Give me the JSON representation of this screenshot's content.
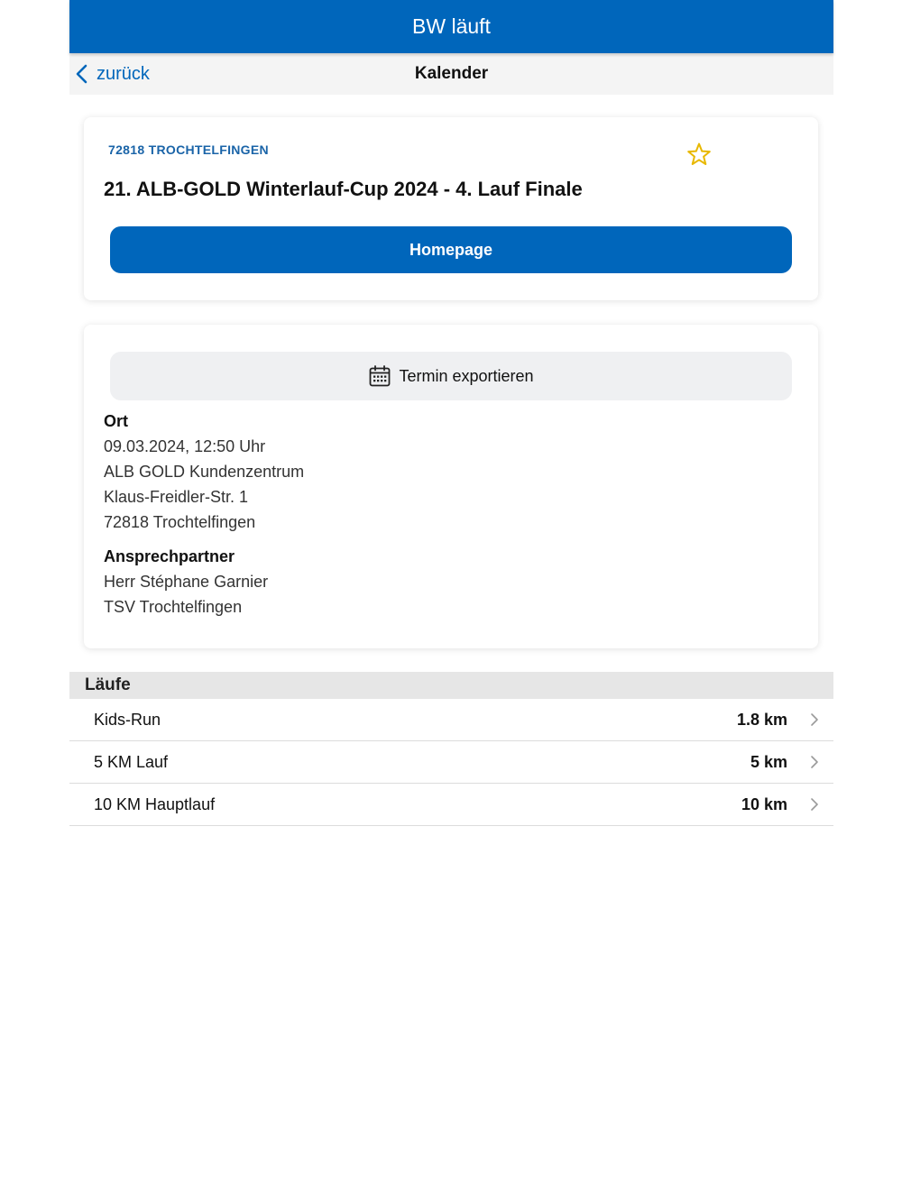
{
  "app": {
    "title": "BW läuft"
  },
  "nav": {
    "back_label": "zurück",
    "title": "Kalender"
  },
  "event": {
    "location_tag": "72818 TROCHTELFINGEN",
    "title": "21. ALB-GOLD Winterlauf-Cup 2024 - 4. Lauf Finale",
    "homepage_label": "Homepage",
    "favorite_icon": "star-outline-icon",
    "accent_color": "#0066bb",
    "star_color": "#e8b800"
  },
  "details": {
    "export_label": "Termin exportieren",
    "ort_label": "Ort",
    "datetime": "09.03.2024, 12:50 Uhr",
    "venue": "ALB GOLD Kundenzentrum",
    "street": "Klaus-Freidler-Str. 1",
    "city": "72818 Trochtelfingen",
    "contact_label": "Ansprechpartner",
    "contact_name": "Herr Stéphane Garnier",
    "contact_org": "TSV Trochtelfingen"
  },
  "races": {
    "header": "Läufe",
    "items": [
      {
        "name": "Kids-Run",
        "distance": "1.8 km"
      },
      {
        "name": "5 KM Lauf",
        "distance": "5 km"
      },
      {
        "name": "10 KM Hauptlauf",
        "distance": "10 km"
      }
    ]
  }
}
